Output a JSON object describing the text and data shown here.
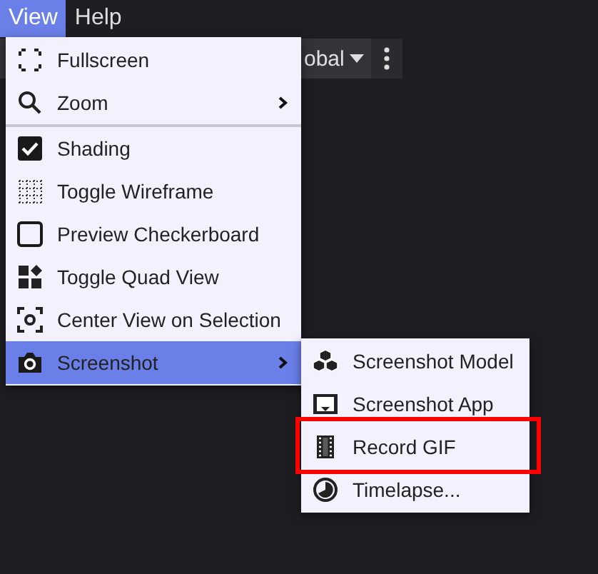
{
  "menubar": [
    {
      "label": "View",
      "selected": true
    },
    {
      "label": "Help",
      "selected": false
    }
  ],
  "toolbar": {
    "dropdown_text": "obal"
  },
  "view_menu": [
    {
      "label": "Fullscreen",
      "kind": "action",
      "submenu": false,
      "divider_after": false,
      "selected": false
    },
    {
      "label": "Zoom",
      "kind": "action",
      "submenu": true,
      "divider_after": true,
      "selected": false
    },
    {
      "label": "Shading",
      "kind": "checkbox",
      "checked": true,
      "submenu": false,
      "divider_after": false,
      "selected": false
    },
    {
      "label": "Toggle Wireframe",
      "kind": "action",
      "submenu": false,
      "divider_after": false,
      "selected": false
    },
    {
      "label": "Preview Checkerboard",
      "kind": "checkbox",
      "checked": false,
      "submenu": false,
      "divider_after": false,
      "selected": false
    },
    {
      "label": "Toggle Quad View",
      "kind": "action",
      "submenu": false,
      "divider_after": false,
      "selected": false
    },
    {
      "label": "Center View on Selection",
      "kind": "action",
      "submenu": false,
      "divider_after": false,
      "selected": false
    },
    {
      "label": "Screenshot",
      "kind": "action",
      "submenu": true,
      "divider_after": false,
      "selected": true
    }
  ],
  "screenshot_submenu": [
    {
      "label": "Screenshot Model",
      "selected": false,
      "outlined": false
    },
    {
      "label": "Screenshot App",
      "selected": false,
      "outlined": false
    },
    {
      "label": "Record GIF",
      "selected": false,
      "outlined": true
    },
    {
      "label": "Timelapse...",
      "selected": false,
      "outlined": false
    }
  ]
}
